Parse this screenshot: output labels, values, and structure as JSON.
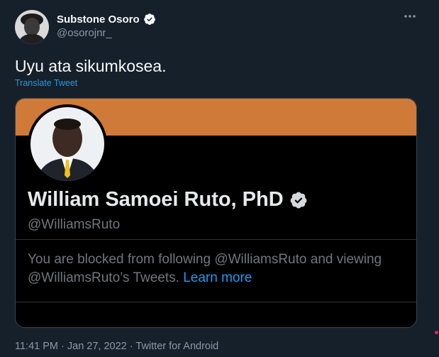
{
  "author": {
    "name": "Substone Osoro",
    "handle": "@osorojnr_"
  },
  "tweet": {
    "text": "Uyu ata sikumkosea.",
    "translate_label": "Translate Tweet"
  },
  "card": {
    "banner_color": "#cf7a38",
    "name": "William Samoei Ruto, PhD",
    "handle": "@WilliamsRuto",
    "message_prefix": "You are blocked from following @WilliamsRuto and viewing @WilliamsRuto’s Tweets. ",
    "learn_more_label": "Learn more"
  },
  "meta": {
    "time": "11:41 PM",
    "date": "Jan 27, 2022",
    "source": "Twitter for Android"
  },
  "icons": {
    "verified": "verified-badge-icon",
    "more": "more-options-icon"
  }
}
